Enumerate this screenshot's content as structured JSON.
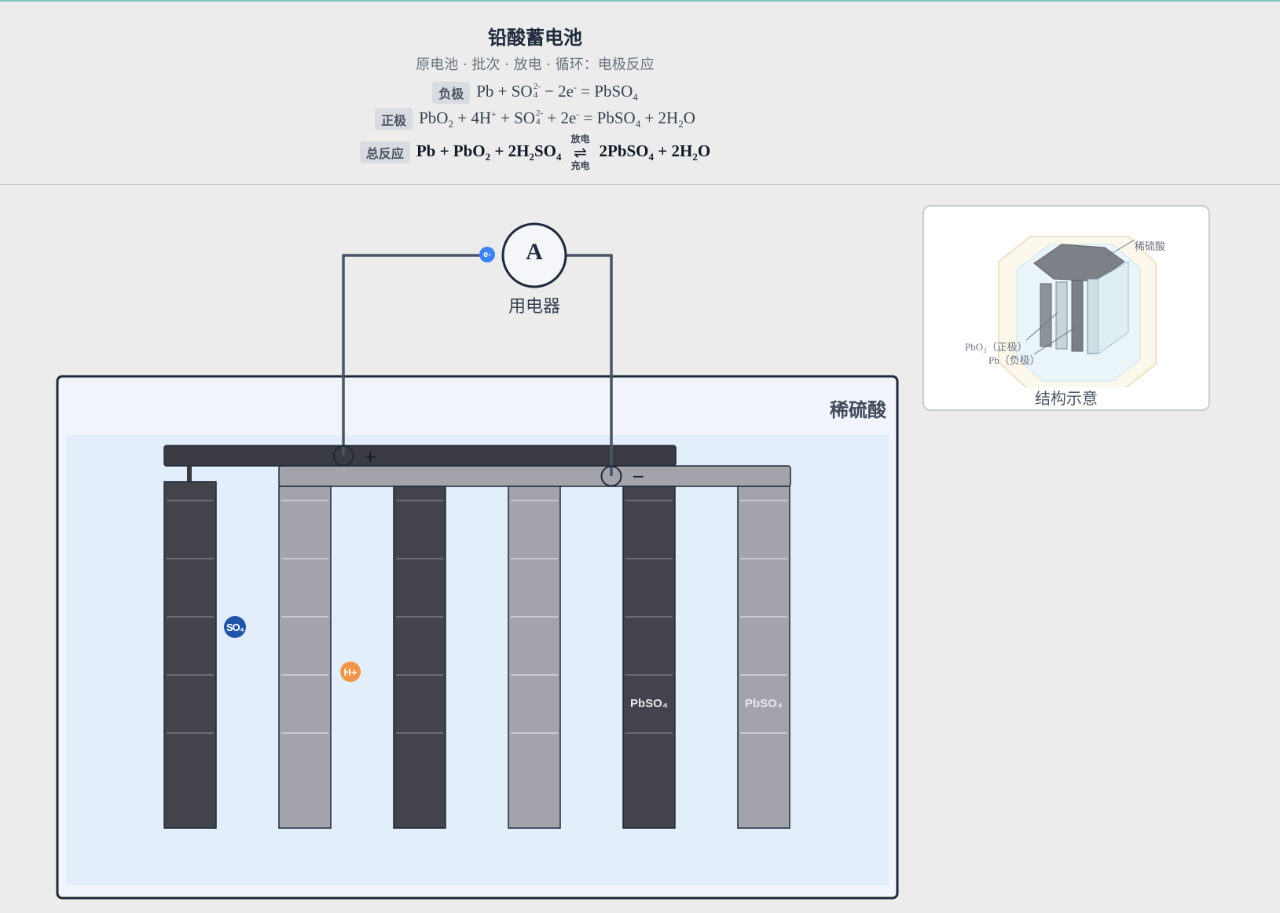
{
  "header": {
    "title": "铅酸蓄电池",
    "subtitle": "原电池 · 批次 · 放电 · 循环：电极反应"
  },
  "equations": {
    "negative": {
      "tag": "负极",
      "left": "Pb + SO",
      "so4_sub": "4",
      "so4_sup": "2-",
      "middle": " − 2e",
      "e_sup": "-",
      "right": " = PbSO",
      "right_sub": "4"
    },
    "positive": {
      "tag": "正极",
      "p1": "PbO",
      "p1_sub": "2",
      "p2": " + 4H",
      "h_sup": "+",
      "p3": " + SO",
      "so4_sub": "4",
      "so4_sup": "2-",
      "p4": " + 2e",
      "e_sup": "-",
      "p5": " = PbSO",
      "p5_sub": "4",
      "p6": " + 2H",
      "h2_sub": "2",
      "p7": "O"
    },
    "total": {
      "tag": "总反应",
      "l1": "Pb + PbO",
      "l1_sub": "2",
      "l2": " + 2H",
      "l2_sub": "2",
      "l3": "SO",
      "l3_sub": "4",
      "discharge": "放电",
      "charge": "充电",
      "r1": "2PbSO",
      "r1_sub": "4",
      "r2": " + 2H",
      "r2_sub": "2",
      "r3": "O"
    }
  },
  "diagram": {
    "electrolyte_label": "稀硫酸",
    "ammeter_symbol": "A",
    "load_label": "用电器",
    "electron_label": "e-",
    "ion_so4": "SO₄",
    "ion_h": "H+",
    "deposit_label": "PbSO₄",
    "plus_symbol": "+",
    "minus_symbol": "−",
    "colors": {
      "dark_plate": "#43444b",
      "light_plate": "#a3a3ab",
      "electrolyte": "#e3eefb",
      "wire": "#4b5563",
      "electron": "#3b82f6",
      "sulfate": "#1e55a8",
      "hydrogen": "#f0964a"
    }
  },
  "structure": {
    "caption": "结构示意",
    "label_acid": "稀硫酸",
    "label_pbo2": "PbO₂（正极）",
    "label_pb": "Pb（负极）"
  }
}
